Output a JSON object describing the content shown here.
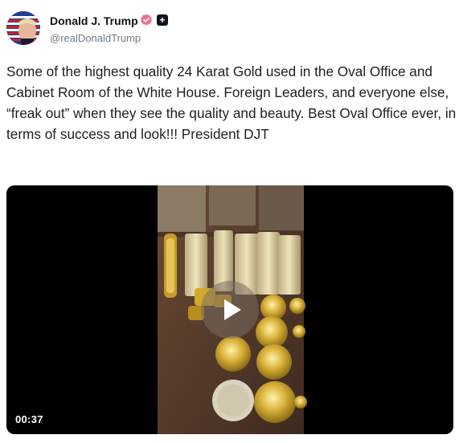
{
  "author": {
    "display_name": "Donald J. Trump",
    "handle": "@realDonaldTrump",
    "verified_icon": "verified-badge-icon",
    "extra_badge": "+"
  },
  "post": {
    "text": "Some of the highest quality 24 Karat Gold used in the Oval Office and Cabinet Room of the White House. Foreign Leaders, and everyone else, “freak out” when they see the quality and beauty. Best Oval Office ever, in terms of success and look!!! President DJT"
  },
  "video": {
    "duration": "00:37",
    "play_icon": "play-icon"
  },
  "colors": {
    "verified_badge": "#f26b8a",
    "handle_text": "#6e7a86",
    "media_background": "#000000"
  }
}
